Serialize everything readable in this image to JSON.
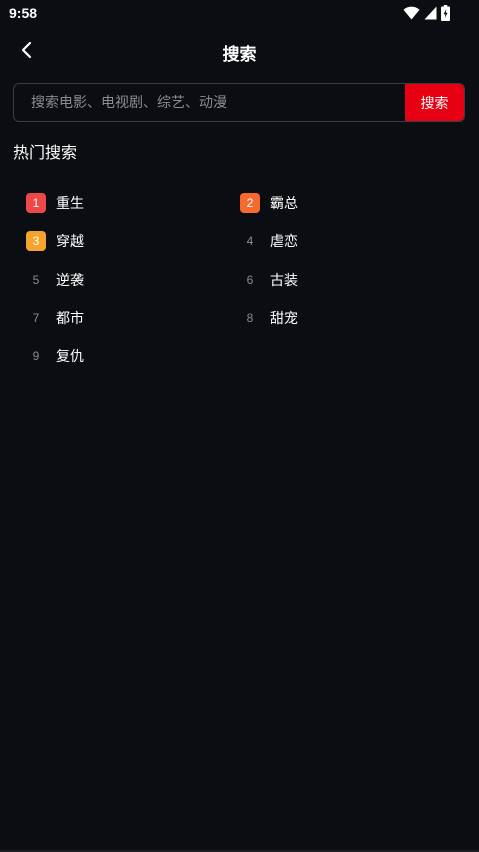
{
  "status_bar": {
    "time": "9:58",
    "icons": [
      "wifi-icon",
      "signal-icon",
      "battery-icon"
    ]
  },
  "nav": {
    "title": "搜索",
    "back_icon": "chevron-left-icon"
  },
  "search": {
    "placeholder": "搜索电影、电视剧、综艺、动漫",
    "value": "",
    "button_label": "搜索",
    "button_color": "#e60012"
  },
  "hot": {
    "title": "热门搜索",
    "items": [
      {
        "rank": "1",
        "label": "重生",
        "badge_color": "#f04848"
      },
      {
        "rank": "2",
        "label": "霸总",
        "badge_color": "#f56b2f"
      },
      {
        "rank": "3",
        "label": "穿越",
        "badge_color": "#f7a42c"
      },
      {
        "rank": "4",
        "label": "虐恋"
      },
      {
        "rank": "5",
        "label": "逆袭"
      },
      {
        "rank": "6",
        "label": "古装"
      },
      {
        "rank": "7",
        "label": "都市"
      },
      {
        "rank": "8",
        "label": "甜宠"
      },
      {
        "rank": "9",
        "label": "复仇"
      }
    ]
  }
}
